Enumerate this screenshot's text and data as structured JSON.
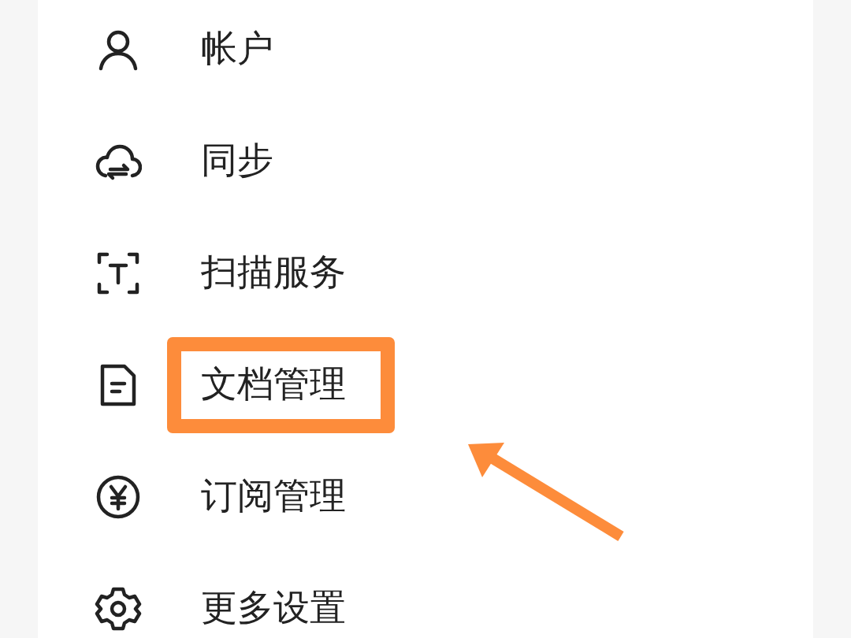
{
  "menu": {
    "items": [
      {
        "kind": "account",
        "label": "帐户",
        "highlighted": false
      },
      {
        "kind": "sync",
        "label": "同步",
        "highlighted": false
      },
      {
        "kind": "scan",
        "label": "扫描服务",
        "highlighted": false
      },
      {
        "kind": "document",
        "label": "文档管理",
        "highlighted": true
      },
      {
        "kind": "subscription",
        "label": "订阅管理",
        "highlighted": false
      },
      {
        "kind": "settings",
        "label": "更多设置",
        "highlighted": false
      }
    ]
  }
}
